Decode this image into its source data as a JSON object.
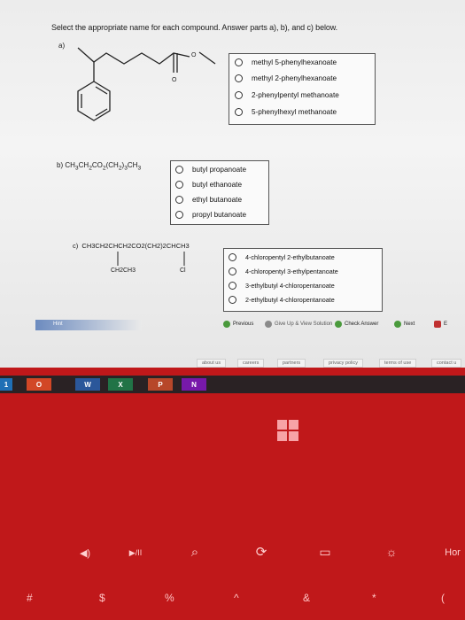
{
  "instructions": "Select the appropriate name for each compound. Answer parts a), b), and c) below.",
  "question_a": {
    "label": "a)",
    "structure_labels": {
      "oxygen_single": "O",
      "oxygen_double": "O"
    },
    "options": [
      "methyl 5-phenylhexanoate",
      "methyl 2-phenylhexanoate",
      "2-phenylpentyl methanoate",
      "5-phenylhexyl methanoate"
    ]
  },
  "question_b": {
    "label": "b)",
    "formula_parts": [
      "CH",
      "3",
      "CH",
      "2",
      "CO",
      "2",
      "(CH",
      "2",
      ")",
      "3",
      "CH",
      "3"
    ],
    "options": [
      "butyl propanoate",
      "butyl ethanoate",
      "ethyl butanoate",
      "propyl butanoate"
    ]
  },
  "question_c": {
    "label": "c)",
    "formula_main": "CH3CH2CHCH2CO2(CH2)2CHCH3",
    "substituent_left": "CH2CH3",
    "substituent_right": "Cl",
    "options": [
      "4-chloropentyl 2-ethylbutanoate",
      "4-chloropentyl 3-ethylpentanoate",
      "3-ethylbutyl 4-chloropentanoate",
      "2-ethylbutyl 4-chloropentanoate"
    ]
  },
  "toolbar": {
    "hint": "Hint",
    "previous": "Previous",
    "give_up": "Give Up & View Solution",
    "check": "Check Answer",
    "next": "Next",
    "exit": "E"
  },
  "footer": [
    "about us",
    "careers",
    "partners",
    "privacy policy",
    "terms of use",
    "contact u"
  ],
  "taskbar": {
    "apps": [
      {
        "name": "O",
        "color": "#d24726"
      },
      {
        "name": "W",
        "color": "#2b579a"
      },
      {
        "name": "X",
        "color": "#217346"
      },
      {
        "name": "P",
        "color": "#b7472a"
      },
      {
        "name": "N",
        "color": "#7719aa"
      }
    ],
    "number": "1"
  },
  "keyboard": {
    "fn_row": [
      "◀)",
      "▶/II",
      "⌕",
      "⟳",
      "▭",
      "☼",
      "Hor"
    ],
    "num_row": [
      "#",
      "$",
      "%",
      "^",
      "&",
      "*",
      "("
    ]
  }
}
